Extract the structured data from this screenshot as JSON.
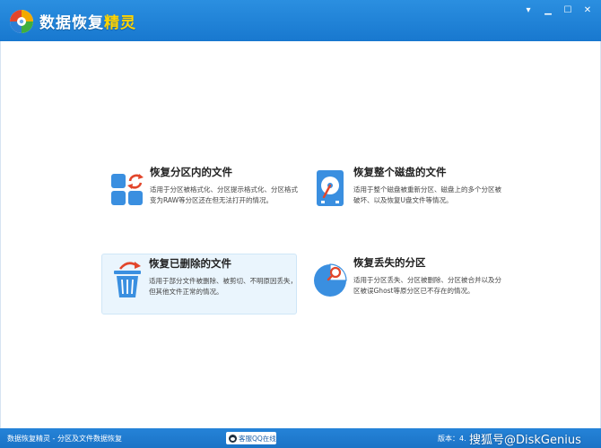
{
  "app": {
    "title_main": "数据恢复",
    "title_accent": "精灵"
  },
  "window_controls": {
    "menu": "▾",
    "minimize": "▁",
    "maximize": "☐",
    "close": "✕"
  },
  "options": [
    {
      "title": "恢复分区内的文件",
      "desc": "适用于分区被格式化、分区提示格式化、分区格式变为RAW等分区还在但无法打开的情况。",
      "icon": "partition-files-icon"
    },
    {
      "title": "恢复整个磁盘的文件",
      "desc": "适用于整个磁盘被重新分区、磁盘上的多个分区被破坏、以及恢复U盘文件等情况。",
      "icon": "disk-icon"
    },
    {
      "title": "恢复已删除的文件",
      "desc": "适用于部分文件被删除、被剪切、不明原因丢失，但其他文件正常的情况。",
      "icon": "recycle-bin-icon"
    },
    {
      "title": "恢复丢失的分区",
      "desc": "适用于分区丢失、分区被删除、分区被合并以及分区被误Ghost等原分区已不存在的情况。",
      "icon": "lost-partition-icon"
    }
  ],
  "statusbar": {
    "left_text": "数据恢复精灵 - 分区及文件数据恢复",
    "support_label": "客服QQ在线",
    "version_label": "版本：4.",
    "watermark": "搜狐号@DiskGenius"
  },
  "colors": {
    "titlebar": "#1f82d6",
    "statusbar": "#1b73c6",
    "accent": "#ffd400",
    "icon_blue": "#3a8fe0",
    "icon_red": "#e2462b",
    "hover_bg": "#eaf5fd"
  }
}
